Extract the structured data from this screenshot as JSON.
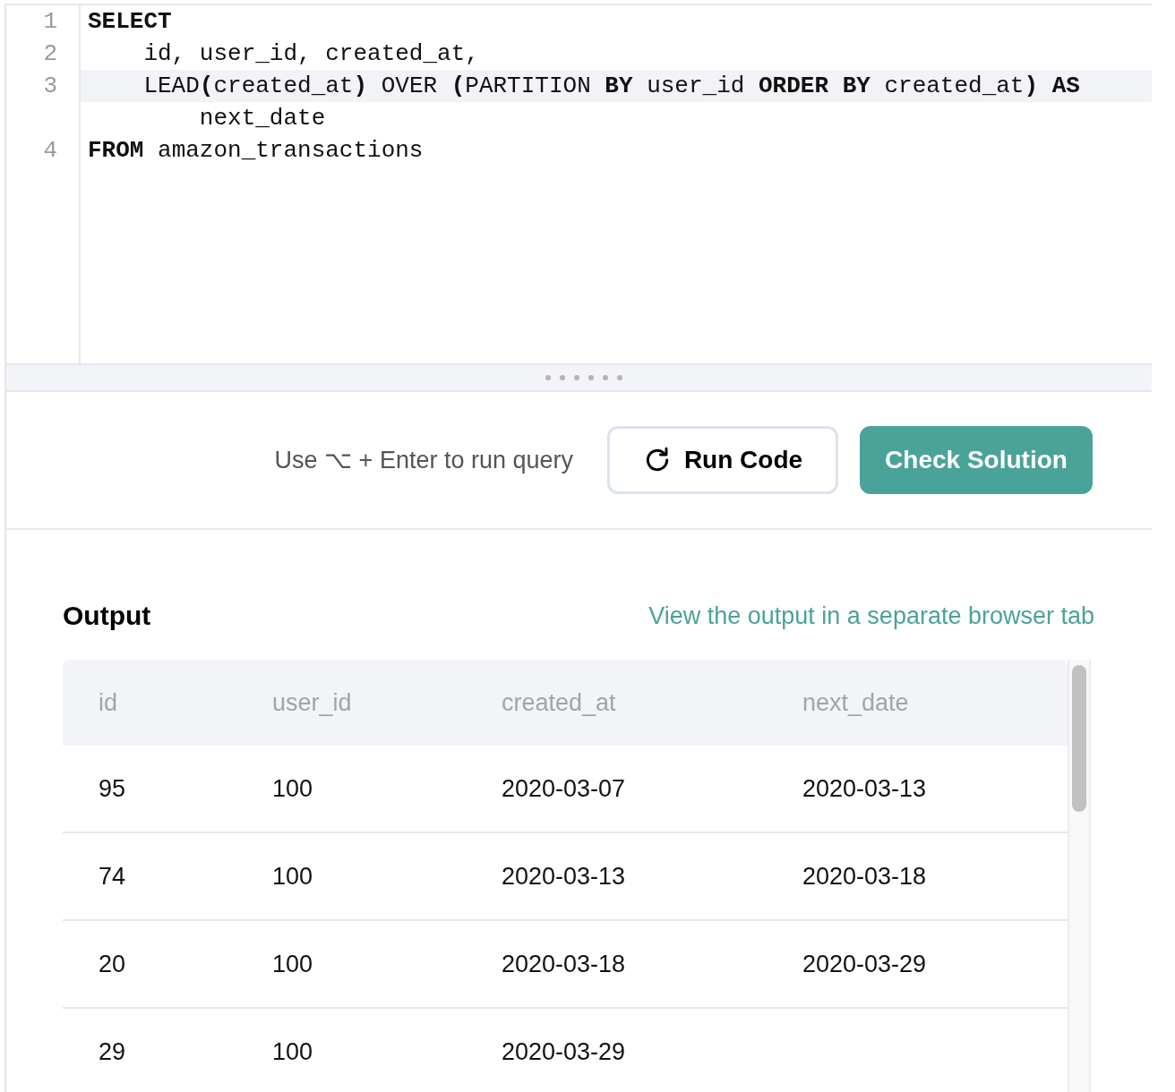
{
  "editor": {
    "lines": [
      {
        "number": "1",
        "text": "**SELECT**",
        "active": false
      },
      {
        "number": "2",
        "text": "    id, user_id, created_at,",
        "active": false
      },
      {
        "number": "3",
        "text": "    LEAD**(**created_at**)** OVER **(**PARTITION **BY** user_id **ORDER** **BY** created_at**)** **AS**",
        "continued": "        next_date",
        "active": true
      },
      {
        "number": "4",
        "text": "**FROM** amazon_transactions",
        "active": false
      }
    ]
  },
  "toolbar": {
    "hint": "Use ⌥ + Enter to run query",
    "run_button": "Run Code",
    "check_button": "Check Solution"
  },
  "output": {
    "title": "Output",
    "link": "View the output in a separate browser tab",
    "table": {
      "columns": [
        "id",
        "user_id",
        "created_at",
        "next_date"
      ],
      "rows": [
        [
          "95",
          "100",
          "2020-03-07",
          "2020-03-13"
        ],
        [
          "74",
          "100",
          "2020-03-13",
          "2020-03-18"
        ],
        [
          "20",
          "100",
          "2020-03-18",
          "2020-03-29"
        ],
        [
          "29",
          "100",
          "2020-03-29"
        ]
      ]
    }
  }
}
